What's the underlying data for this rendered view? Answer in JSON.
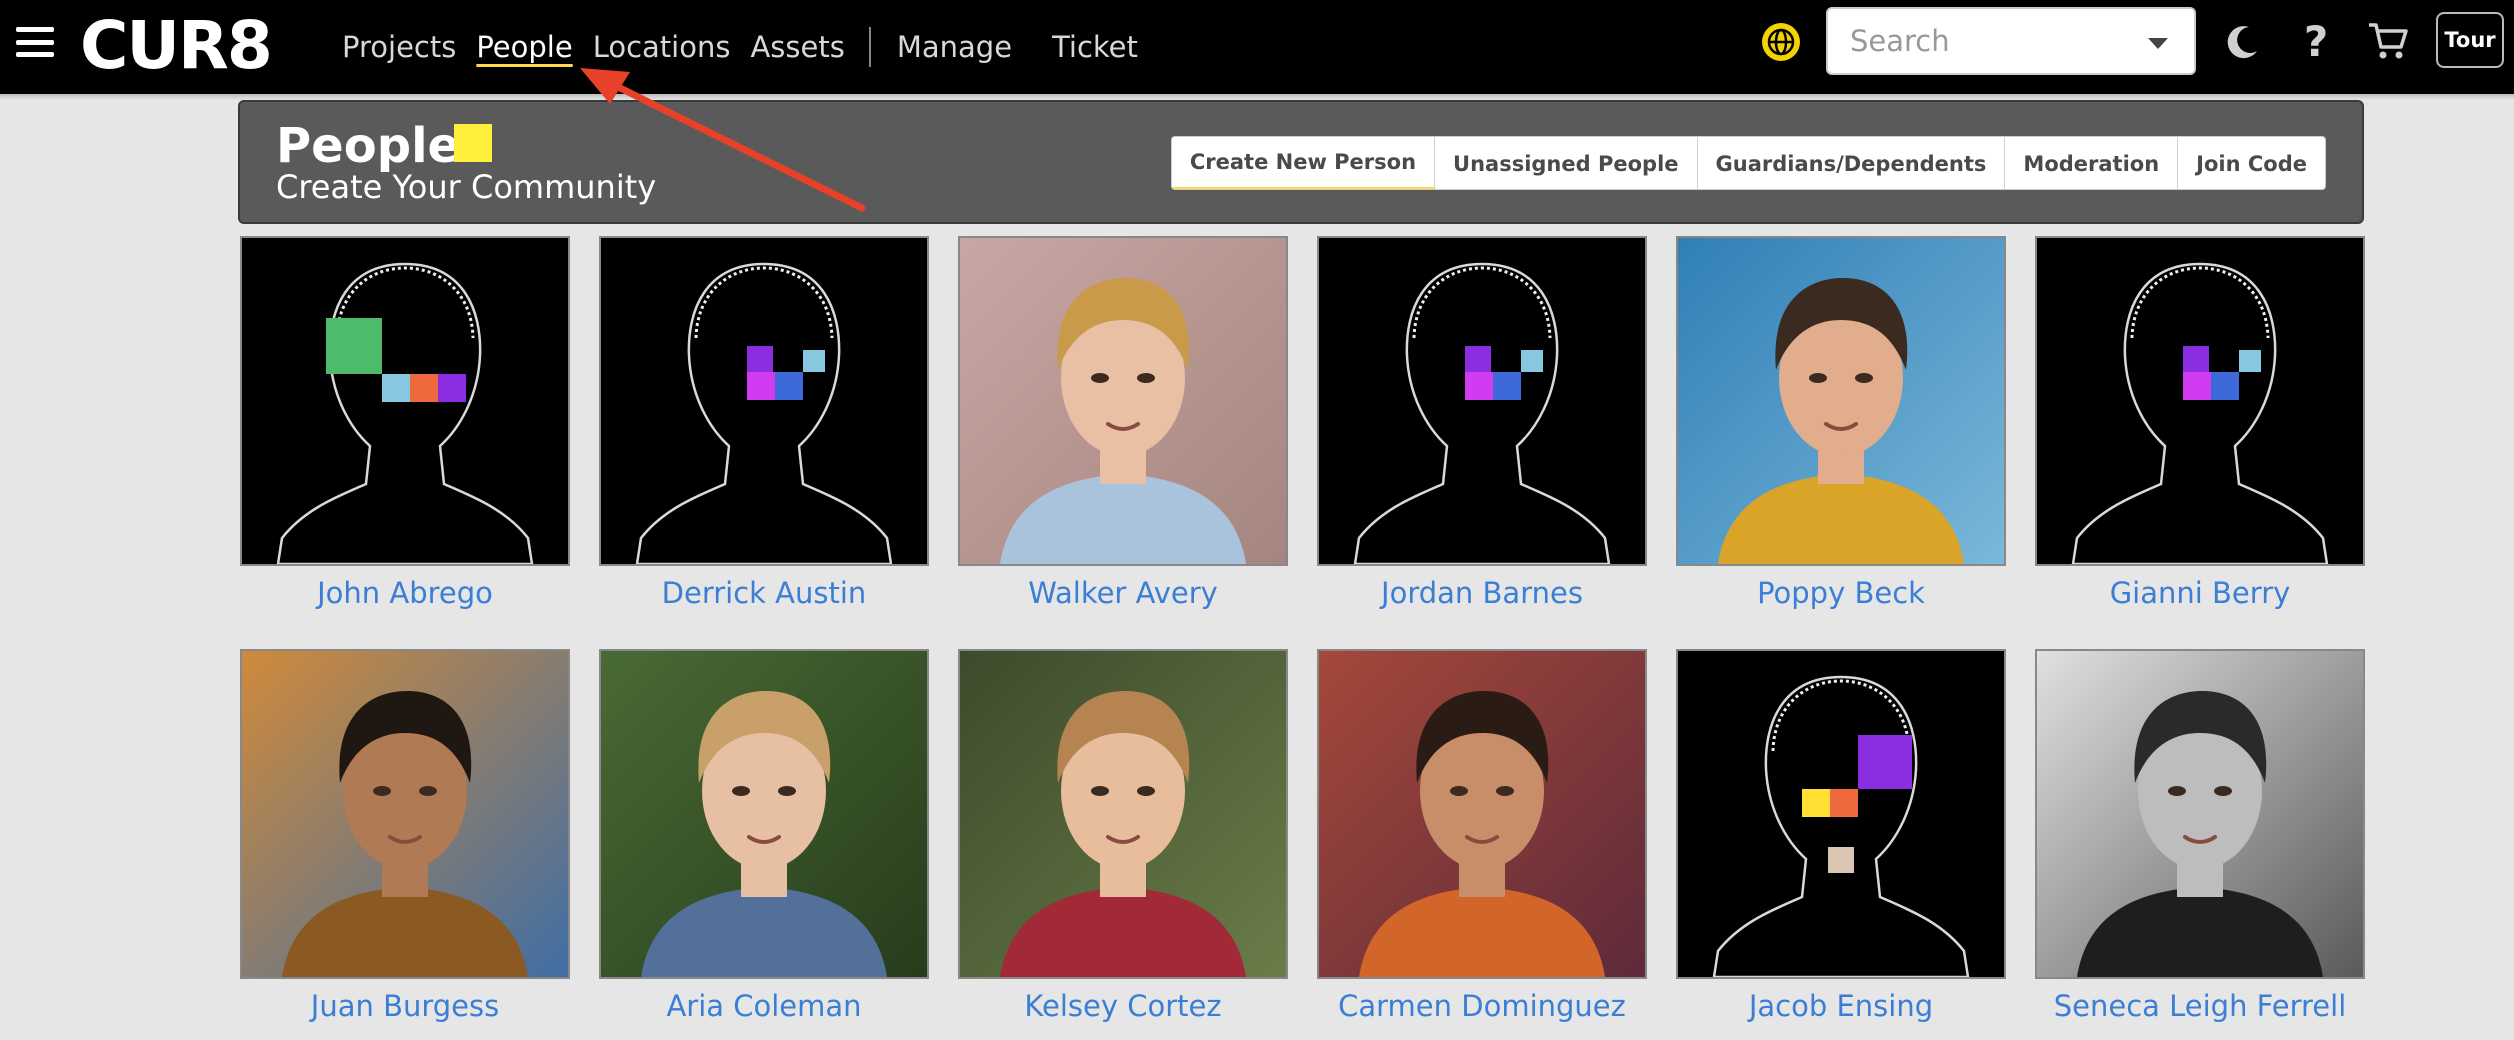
{
  "brand": {
    "logo_text": "CUR8"
  },
  "nav": {
    "items": [
      {
        "label": "Projects"
      },
      {
        "label": "People"
      },
      {
        "label": "Locations"
      },
      {
        "label": "Assets"
      },
      {
        "label": "Manage"
      },
      {
        "label": "Ticket"
      }
    ],
    "active": "People"
  },
  "search": {
    "placeholder": "Search"
  },
  "toolbar": {
    "tour_label": "Tour",
    "help_label": "?"
  },
  "header": {
    "title": "People",
    "subtitle": "Create Your Community",
    "accent_color": "#ffef3a",
    "actions": [
      {
        "label": "Create New Person"
      },
      {
        "label": "Unassigned People"
      },
      {
        "label": "Guardians/Dependents"
      },
      {
        "label": "Moderation"
      },
      {
        "label": "Join Code"
      }
    ]
  },
  "colors": {
    "link": "#3a7fd5",
    "annotation_arrow": "#e8412a",
    "globe": "#f2d300"
  },
  "people": [
    {
      "name": "John Abrego",
      "photo": "placeholder-silhouette"
    },
    {
      "name": "Derrick Austin",
      "photo": "placeholder-silhouette"
    },
    {
      "name": "Walker Avery",
      "photo": "portrait"
    },
    {
      "name": "Jordan Barnes",
      "photo": "placeholder-silhouette"
    },
    {
      "name": "Poppy Beck",
      "photo": "portrait"
    },
    {
      "name": "Gianni Berry",
      "photo": "placeholder-silhouette"
    },
    {
      "name": "Juan Burgess",
      "photo": "portrait"
    },
    {
      "name": "Aria Coleman",
      "photo": "portrait"
    },
    {
      "name": "Kelsey Cortez",
      "photo": "portrait"
    },
    {
      "name": "Carmen Dominguez",
      "photo": "portrait"
    },
    {
      "name": "Jacob Ensing",
      "photo": "placeholder-silhouette"
    },
    {
      "name": "Seneca Leigh Ferrell",
      "photo": "portrait"
    }
  ]
}
